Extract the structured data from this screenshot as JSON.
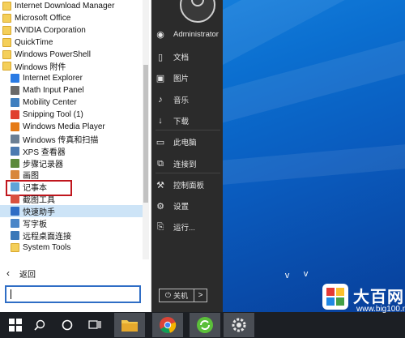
{
  "programs": [
    {
      "label": "Internet Download Manager",
      "icon": "folder-icon",
      "level": 0
    },
    {
      "label": "Microsoft Office",
      "icon": "folder-icon",
      "level": 0
    },
    {
      "label": "NVIDIA Corporation",
      "icon": "folder-icon",
      "level": 0
    },
    {
      "label": "QuickTime",
      "icon": "folder-icon",
      "level": 0
    },
    {
      "label": "Windows PowerShell",
      "icon": "folder-icon",
      "level": 0
    },
    {
      "label": "Windows 附件",
      "icon": "folder-icon",
      "level": 0
    },
    {
      "label": "Internet Explorer",
      "icon": "ie-icon",
      "level": 1,
      "color": "#2a7be4"
    },
    {
      "label": "Math Input Panel",
      "icon": "math-icon",
      "level": 1,
      "color": "#6a6a6a"
    },
    {
      "label": "Mobility Center",
      "icon": "mobility-icon",
      "level": 1,
      "color": "#3f7fbf"
    },
    {
      "label": "Snipping Tool (1)",
      "icon": "scissors-icon",
      "level": 1,
      "color": "#e0402f"
    },
    {
      "label": "Windows Media Player",
      "icon": "media-player-icon",
      "level": 1,
      "color": "#e57a16"
    },
    {
      "label": "Windows 传真和扫描",
      "icon": "fax-icon",
      "level": 1,
      "color": "#6b7f94"
    },
    {
      "label": "XPS 查看器",
      "icon": "xps-icon",
      "level": 1,
      "color": "#4c7ab0"
    },
    {
      "label": "步骤记录器",
      "icon": "steps-recorder-icon",
      "level": 1,
      "color": "#5c8a3c"
    },
    {
      "label": "画图",
      "icon": "paint-icon",
      "level": 1,
      "color": "#d8873b"
    },
    {
      "label": "记事本",
      "icon": "notepad-icon",
      "level": 1,
      "color": "#5fa3d8",
      "highlighted": true
    },
    {
      "label": "截图工具",
      "icon": "snip-icon",
      "level": 1,
      "color": "#d9503f"
    },
    {
      "label": "快速助手",
      "icon": "quick-assist-icon",
      "level": 1,
      "color": "#2f6dc5",
      "selected": true
    },
    {
      "label": "写字板",
      "icon": "wordpad-icon",
      "level": 1,
      "color": "#4a86c8"
    },
    {
      "label": "远程桌面连接",
      "icon": "remote-desktop-icon",
      "level": 1,
      "color": "#3a78b8"
    },
    {
      "label": "System Tools",
      "icon": "folder-icon",
      "level": 1
    }
  ],
  "back_label": "返回",
  "search": {
    "value": ""
  },
  "user": {
    "name": "Administrator"
  },
  "right_menu": [
    {
      "label": "文档",
      "icon": "document-icon",
      "glyph": "▯"
    },
    {
      "label": "图片",
      "icon": "picture-icon",
      "glyph": "▣"
    },
    {
      "label": "音乐",
      "icon": "music-icon",
      "glyph": "♪"
    },
    {
      "label": "下载",
      "icon": "download-icon",
      "glyph": "↓"
    },
    {
      "label": "此电脑",
      "icon": "computer-icon",
      "glyph": "▭"
    },
    {
      "label": "连接到",
      "icon": "connect-icon",
      "glyph": "⧉"
    },
    {
      "label": "控制面板",
      "icon": "control-panel-icon",
      "glyph": "⚒"
    },
    {
      "label": "设置",
      "icon": "settings-icon",
      "glyph": "⚙"
    },
    {
      "label": "运行...",
      "icon": "run-icon",
      "glyph": "⎘"
    }
  ],
  "power": {
    "label": "关机",
    "arrow": ">"
  },
  "watermark": {
    "text": "大百网",
    "url": "www.big100.net"
  },
  "colors": {
    "selected": "#cde4f7",
    "highlight_box": "#c0161d",
    "search_border": "#2f6dc5",
    "dark_panel": "#2b2b2b",
    "taskbar": "#1c1f24",
    "desktop": "#0b6fd0"
  }
}
